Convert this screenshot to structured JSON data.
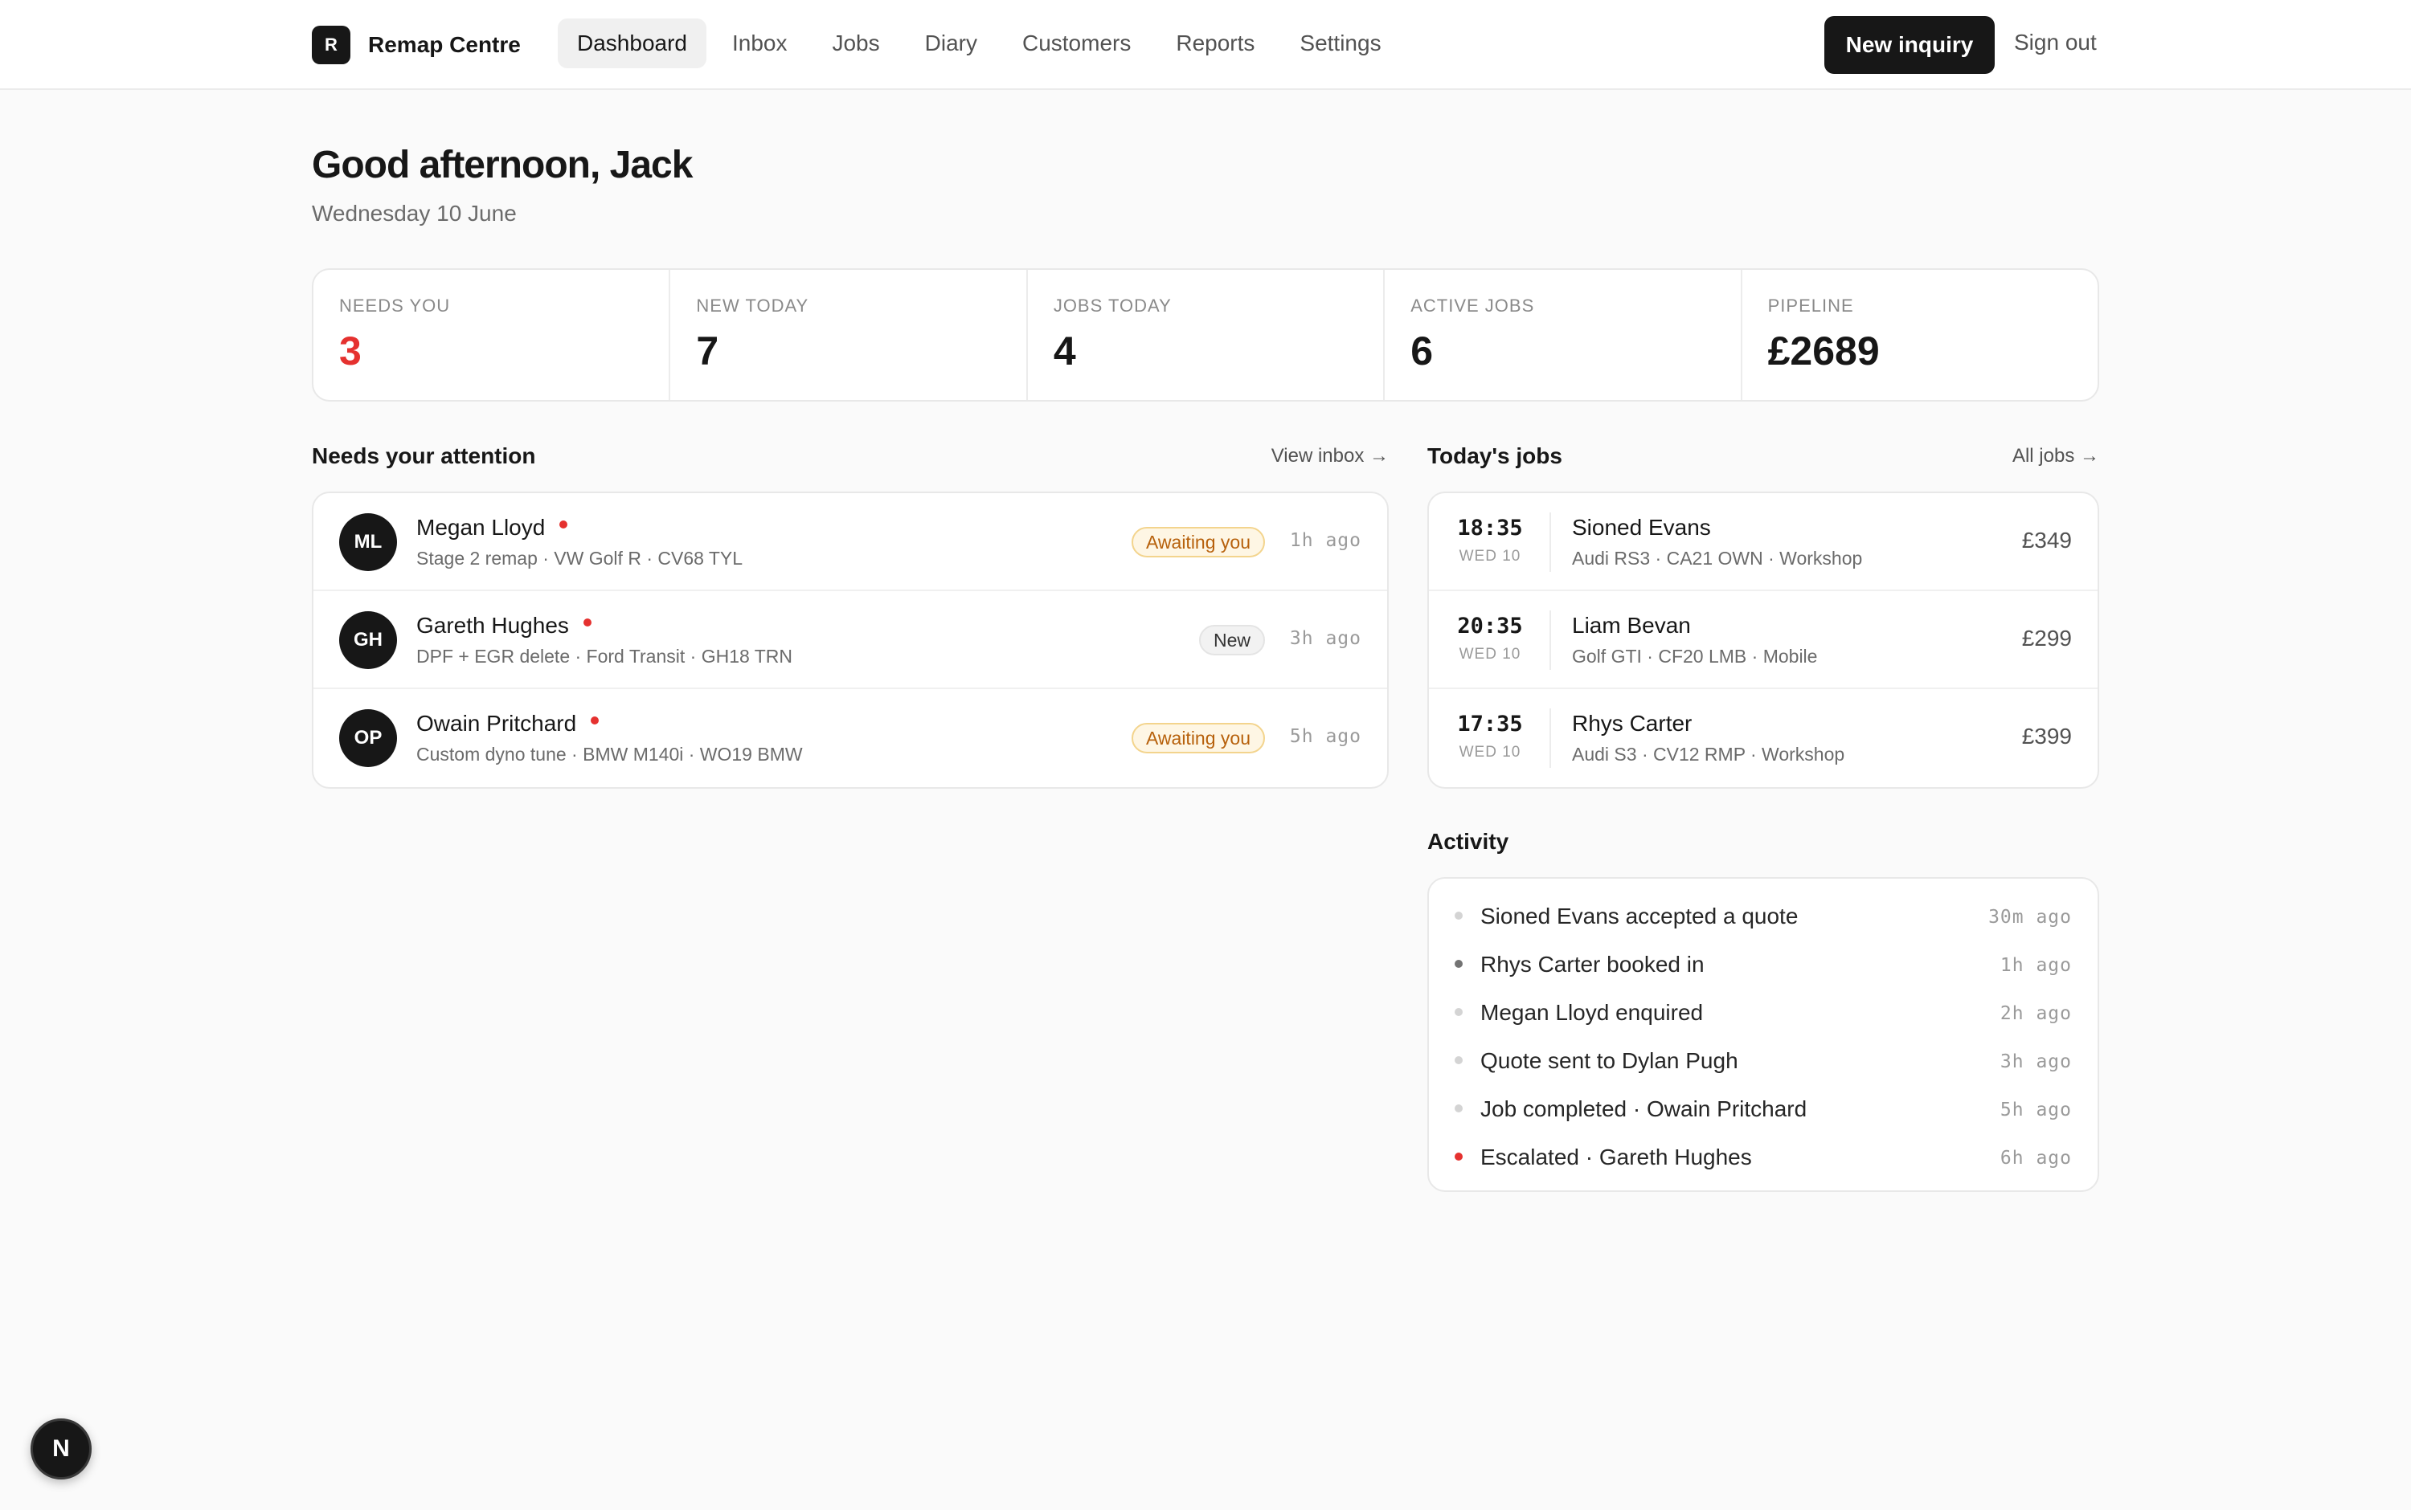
{
  "brand": {
    "logo_letter": "R",
    "name": "Remap Centre"
  },
  "nav": {
    "items": [
      "Dashboard",
      "Inbox",
      "Jobs",
      "Diary",
      "Customers",
      "Reports",
      "Settings"
    ],
    "active": "Dashboard"
  },
  "header_actions": {
    "new_inquiry": "New inquiry",
    "sign_out": "Sign out"
  },
  "greeting": {
    "title": "Good afternoon, Jack",
    "date": "Wednesday 10 June"
  },
  "stats": [
    {
      "label": "NEEDS YOU",
      "value": "3",
      "color": "#e5312f"
    },
    {
      "label": "NEW TODAY",
      "value": "7"
    },
    {
      "label": "JOBS TODAY",
      "value": "4"
    },
    {
      "label": "ACTIVE JOBS",
      "value": "6"
    },
    {
      "label": "PIPELINE",
      "value": "£2689"
    }
  ],
  "attention": {
    "title": "Needs your attention",
    "link": "View inbox →",
    "items": [
      {
        "initials": "ML",
        "name": "Megan Lloyd",
        "sub": "Stage 2 remap · VW Golf R · CV68 TYL",
        "badge": "Awaiting you",
        "ago": "1h ago"
      },
      {
        "initials": "GH",
        "name": "Gareth Hughes",
        "sub": "DPF + EGR delete · Ford Transit · GH18 TRN",
        "badge": "New",
        "ago": "3h ago"
      },
      {
        "initials": "OP",
        "name": "Owain Pritchard",
        "sub": "Custom dyno tune · BMW M140i · WO19 BMW",
        "badge": "Awaiting you",
        "ago": "5h ago"
      }
    ]
  },
  "jobs": {
    "title": "Today's jobs",
    "link": "All jobs →",
    "items": [
      {
        "time": "18:35",
        "day": "WED 10",
        "name": "Sioned Evans",
        "sub": "Audi RS3 · CA21 OWN · Workshop",
        "price": "£349"
      },
      {
        "time": "20:35",
        "day": "WED 10",
        "name": "Liam Bevan",
        "sub": "Golf GTI · CF20 LMB · Mobile",
        "price": "£299"
      },
      {
        "time": "17:35",
        "day": "WED 10",
        "name": "Rhys Carter",
        "sub": "Audi S3 · CV12 RMP · Workshop",
        "price": "£399"
      }
    ]
  },
  "activity": {
    "title": "Activity",
    "items": [
      {
        "text": "Sioned Evans accepted a quote",
        "ago": "30m ago",
        "dot": "light"
      },
      {
        "text": "Rhys Carter booked in",
        "ago": "1h ago",
        "dot": "dark"
      },
      {
        "text": "Megan Lloyd enquired",
        "ago": "2h ago",
        "dot": "light"
      },
      {
        "text": "Quote sent to Dylan Pugh",
        "ago": "3h ago",
        "dot": "light"
      },
      {
        "text": "Job completed · Owain Pritchard",
        "ago": "5h ago",
        "dot": "light"
      },
      {
        "text": "Escalated · Gareth Hughes",
        "ago": "6h ago",
        "dot": "red"
      }
    ]
  },
  "dev_badge": "N"
}
